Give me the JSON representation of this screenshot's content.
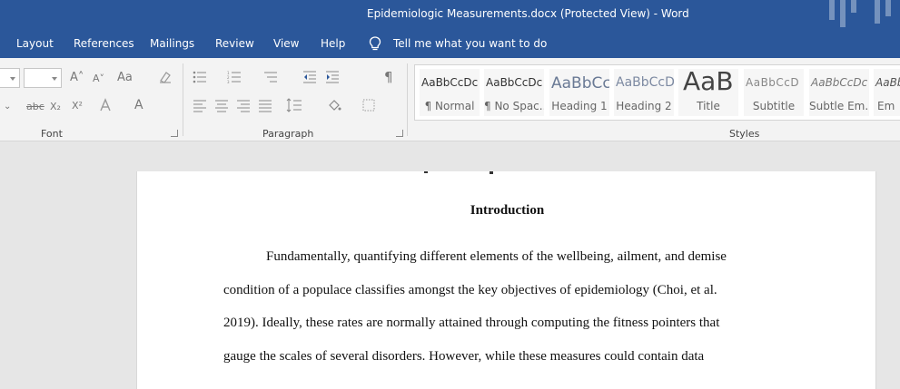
{
  "window": {
    "title": "Epidemiologic Measurements.docx (Protected View)  -  Word"
  },
  "tabs": [
    {
      "label": "Layout"
    },
    {
      "label": "References"
    },
    {
      "label": "Mailings"
    },
    {
      "label": "Review"
    },
    {
      "label": "View"
    },
    {
      "label": "Help"
    }
  ],
  "tell_me": {
    "label": "Tell me what you want to do"
  },
  "groups": {
    "font": "Font",
    "paragraph": "Paragraph",
    "styles": "Styles"
  },
  "font_controls": {
    "grow": "A˄",
    "shrink": "A˅",
    "change_case": "Aa",
    "strikethrough": "abc",
    "subscript": "X₂",
    "superscript": "X²",
    "font_color": "A"
  },
  "styles": [
    {
      "sample": "AaBbCcDc",
      "name": "¶ Normal"
    },
    {
      "sample": "AaBbCcDc",
      "name": "¶ No Spac..."
    },
    {
      "sample": "AaBbCc",
      "name": "Heading 1"
    },
    {
      "sample": "AaBbCcD",
      "name": "Heading 2"
    },
    {
      "sample": "AaB",
      "name": "Title"
    },
    {
      "sample": "AaBbCcD",
      "name": "Subtitle"
    },
    {
      "sample": "AaBbCcDc",
      "name": "Subtle Em..."
    },
    {
      "sample": "AaBb",
      "name": "Em"
    }
  ],
  "document": {
    "heading": "Introduction",
    "lines": [
      "Fundamentally, quantifying different elements of the wellbeing, ailment, and demise",
      "condition of a populace classifies amongst the key objectives of epidemiology (Choi, et al.",
      "2019). Ideally, these rates are normally attained through computing the fitness pointers that",
      "gauge the scales of several disorders. However, while these measures could contain data"
    ]
  },
  "colors": {
    "titlebar": "#2b579a",
    "ribbon": "#f3f3f3",
    "canvas": "#e6e6e6",
    "page": "#ffffff"
  }
}
